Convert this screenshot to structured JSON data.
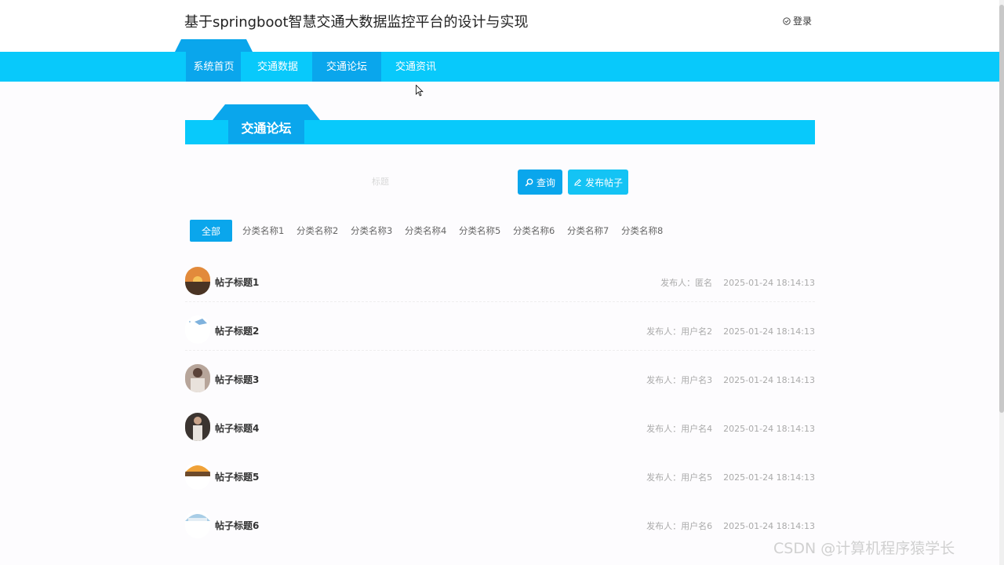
{
  "header": {
    "title": "基于springboot智慧交通大数据监控平台的设计与实现",
    "login_label": "登录"
  },
  "nav": {
    "items": [
      {
        "label": "系统首页"
      },
      {
        "label": "交通数据"
      },
      {
        "label": "交通论坛"
      },
      {
        "label": "交通资讯"
      }
    ],
    "active": "交通论坛"
  },
  "section": {
    "title": "交通论坛"
  },
  "search": {
    "placeholder": "标题",
    "search_label": "查询",
    "post_label": "发布帖子"
  },
  "categories": {
    "all": "全部",
    "items": [
      "分类名称1",
      "分类名称2",
      "分类名称3",
      "分类名称4",
      "分类名称5",
      "分类名称6",
      "分类名称7",
      "分类名称8"
    ]
  },
  "posts": [
    {
      "title": "帖子标题1",
      "author": "发布人：匿名",
      "time": "2025-01-24 18:14:13"
    },
    {
      "title": "帖子标题2",
      "author": "发布人：用户名2",
      "time": "2025-01-24 18:14:13"
    },
    {
      "title": "帖子标题3",
      "author": "发布人：用户名3",
      "time": "2025-01-24 18:14:13"
    },
    {
      "title": "帖子标题4",
      "author": "发布人：用户名4",
      "time": "2025-01-24 18:14:13"
    },
    {
      "title": "帖子标题5",
      "author": "发布人：用户名5",
      "time": "2025-01-24 18:14:13"
    },
    {
      "title": "帖子标题6",
      "author": "发布人：用户名6",
      "time": "2025-01-24 18:14:13"
    }
  ],
  "watermark": "CSDN @计算机程序猿学长",
  "colors": {
    "nav_bg": "#08c9fb",
    "accent": "#0aa6ec"
  }
}
